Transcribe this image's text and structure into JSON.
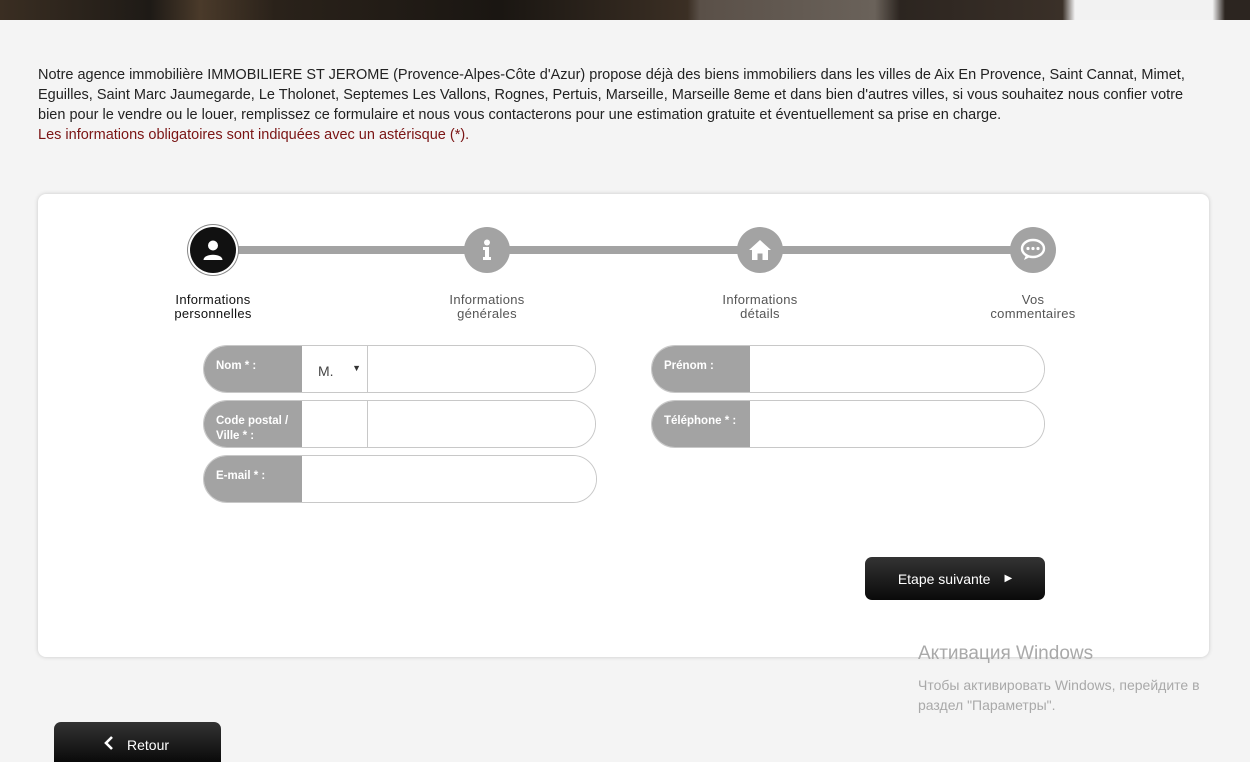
{
  "intro": {
    "text": "Notre agence immobilière IMMOBILIERE ST JEROME (Provence-Alpes-Côte d'Azur) propose déjà des biens immobiliers dans les villes de Aix En Provence, Saint Cannat, Mimet, Eguilles, Saint Marc Jaumegarde, Le Tholonet, Septemes Les Vallons, Rognes, Pertuis, Marseille, Marseille 8eme et dans bien d'autres villes, si vous souhaitez nous confier votre bien pour le vendre ou le louer, remplissez ce formulaire et nous vous contacterons pour une estimation gratuite et éventuellement sa prise en charge.",
    "mandatory_note": "Les informations obligatoires sont indiquées avec un astérisque (*).",
    "mandatory_color": "#7a1414"
  },
  "steps": [
    {
      "label_line1": "Informations",
      "label_line2": "personnelles",
      "icon": "person-icon",
      "active": true
    },
    {
      "label_line1": "Informations",
      "label_line2": "générales",
      "icon": "info-icon",
      "active": false
    },
    {
      "label_line1": "Informations",
      "label_line2": "détails",
      "icon": "home-icon",
      "active": false
    },
    {
      "label_line1": "Vos",
      "label_line2": "commentaires",
      "icon": "chat-icon",
      "active": false
    }
  ],
  "form": {
    "nom_label": "Nom * :",
    "civility_value": "M.",
    "prenom_label": "Prénom :",
    "code_postal_label_line1": "Code postal /",
    "code_postal_label_line2": "Ville * :",
    "telephone_label": "Téléphone * :",
    "email_label": "E-mail * :"
  },
  "buttons": {
    "next_label": "Etape suivante",
    "back_label": "Retour"
  },
  "windows_activation": {
    "title": "Активация Windows",
    "subtitle": "Чтобы активировать Windows, перейдите в раздел \"Параметры\"."
  },
  "colors": {
    "step_inactive": "#a3a3a3",
    "step_active": "#111111",
    "button": "#111111"
  }
}
